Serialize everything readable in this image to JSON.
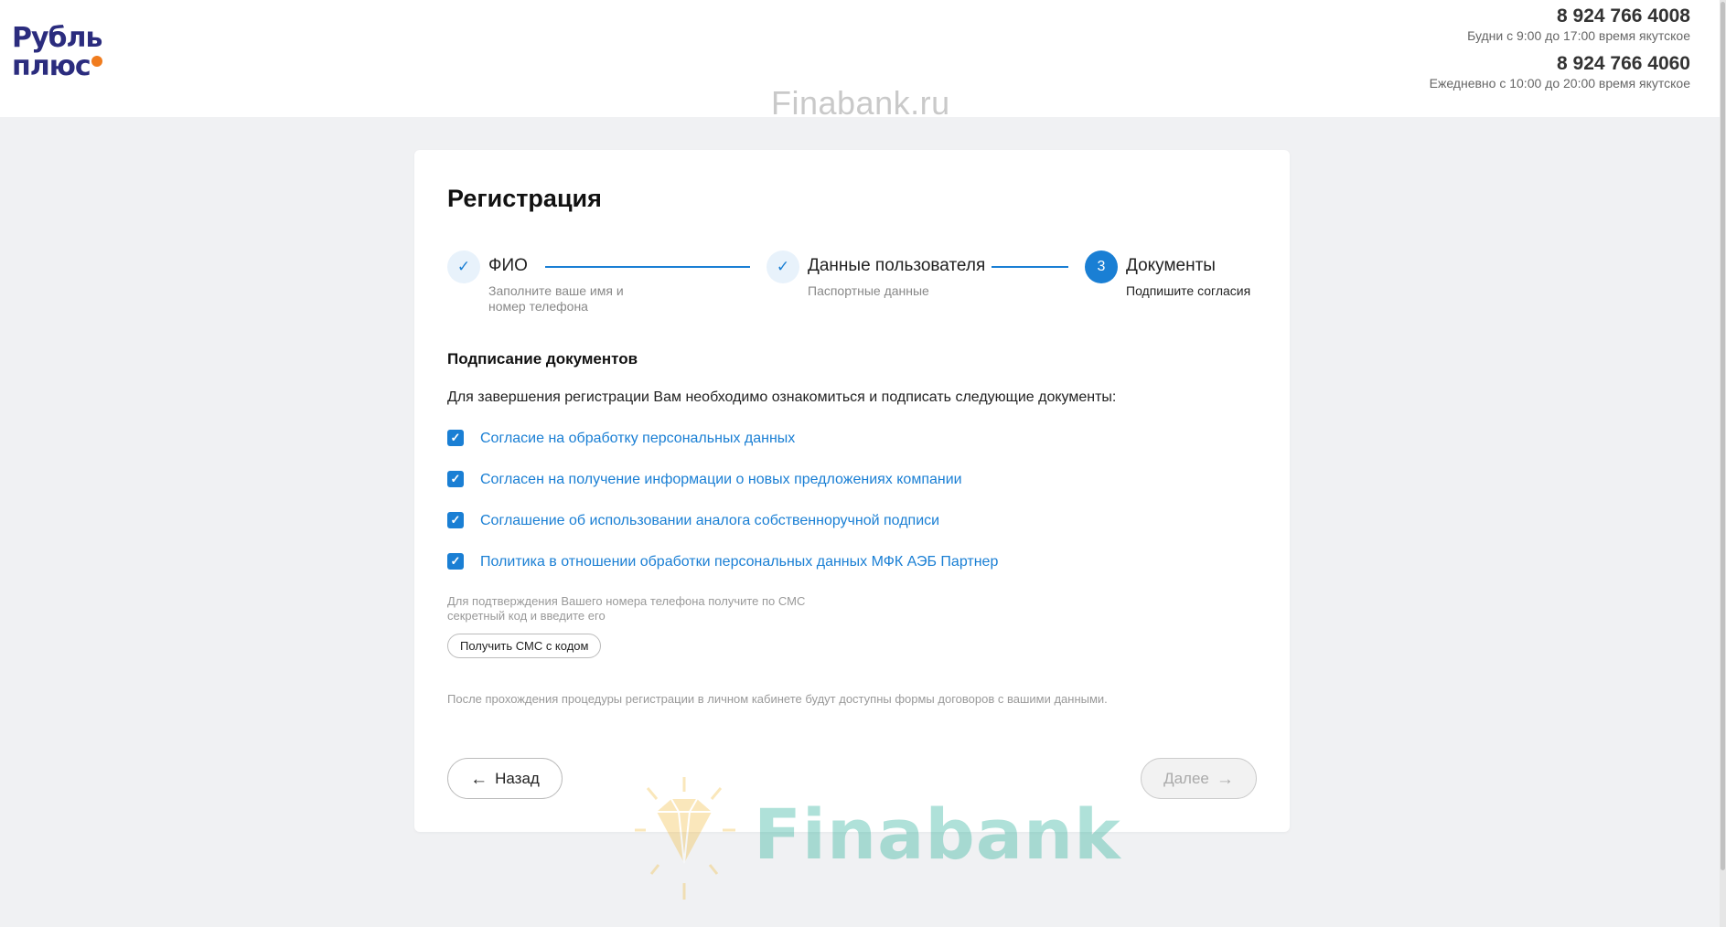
{
  "header": {
    "logo": {
      "line1": "Рубль",
      "line2": "плюс"
    },
    "contacts": [
      {
        "phone": "8 924 766 4008",
        "hours": "Будни с 9:00 до 17:00 время якутское"
      },
      {
        "phone": "8 924 766 4060",
        "hours": "Ежедневно с 10:00 до 20:00 время якутское"
      }
    ]
  },
  "watermark": {
    "top": "Finabank.ru",
    "bottom": "Finabank"
  },
  "registration": {
    "title": "Регистрация",
    "steps": [
      {
        "marker": "✓",
        "title": "ФИО",
        "subtitle_line1": "Заполните ваше имя и",
        "subtitle_line2": "номер телефона",
        "state": "done"
      },
      {
        "marker": "✓",
        "title": "Данные пользователя",
        "subtitle_line1": "Паспортные данные",
        "state": "done"
      },
      {
        "marker": "3",
        "title": "Документы",
        "subtitle_line1": "Подпишите согласия",
        "state": "active"
      }
    ],
    "section_title": "Подписание документов",
    "intro": "Для завершения регистрации Вам необходимо ознакомиться и подписать следующие документы:",
    "documents": [
      {
        "label": "Согласие на обработку персональных данных",
        "checked": true
      },
      {
        "label": "Согласен на получение информации о новых предложениях компании",
        "checked": true
      },
      {
        "label": "Соглашение об использовании аналога собственноручной подписи",
        "checked": true
      },
      {
        "label": "Политика в отношении обработки персональных данных МФК АЭБ Партнер",
        "checked": true
      }
    ],
    "sms_hint_line1": "Для подтверждения Вашего номера телефона получите по СМС",
    "sms_hint_line2": "секретный код и введите его",
    "sms_button": "Получить СМС с кодом",
    "after_note": "После прохождения процедуры регистрации в личном кабинете будут доступны формы договоров с вашими данными.",
    "back_button": "Назад",
    "next_button": "Далее"
  },
  "colors": {
    "accent": "#1a7fd4",
    "brand": "#2b2c7e",
    "brand_dot": "#f07c1e",
    "background": "#f0f1f3"
  },
  "icons": {
    "checkbox": "check-icon",
    "back": "arrow-left-icon",
    "next": "arrow-right-icon",
    "watermark_logo": "diamond-icon"
  }
}
